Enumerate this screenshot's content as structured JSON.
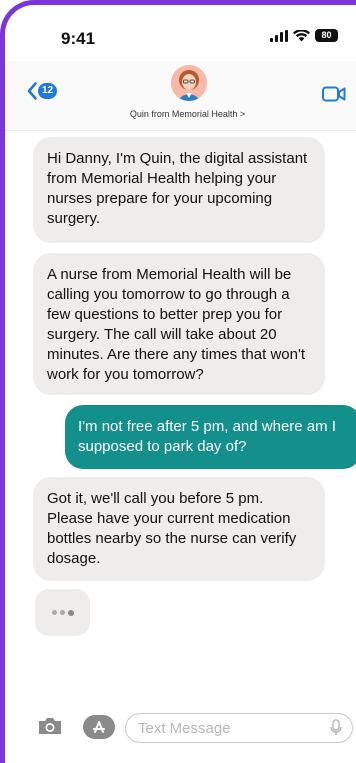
{
  "status_bar": {
    "time": "9:41",
    "battery_level": "80"
  },
  "nav": {
    "back_badge_count": "12",
    "contact_name": "Quin from Memorial Health >"
  },
  "messages": [
    {
      "direction": "incoming",
      "text": "Hi Danny, I'm Quin, the digital assistant from Memorial Health helping your nurses prepare for your upcoming surgery."
    },
    {
      "direction": "incoming",
      "text": "A nurse from Memorial Health will be calling you tomorrow to go through a few questions to better prep you for surgery. The call will take about 20 minutes. Are there any times that won't work for you tomorrow?"
    },
    {
      "direction": "outgoing",
      "text": "I'm not free after 5 pm, and where am I supposed to park day of?"
    },
    {
      "direction": "incoming",
      "text": "Got it, we'll call you before 5 pm. Please have your current medication bottles nearby so the nurse can verify dosage."
    }
  ],
  "composer": {
    "placeholder": "Text Message"
  },
  "colors": {
    "frame": "#7b35d8",
    "incoming_bubble": "#efedeb",
    "outgoing_bubble": "#13908c",
    "ios_blue": "#1f7ae0"
  },
  "icons": {
    "back": "chevron-left-icon",
    "video": "video-camera-icon",
    "camera": "camera-icon",
    "apps": "app-store-icon",
    "mic": "microphone-icon",
    "signal": "cellular-signal-icon",
    "wifi": "wifi-icon"
  }
}
